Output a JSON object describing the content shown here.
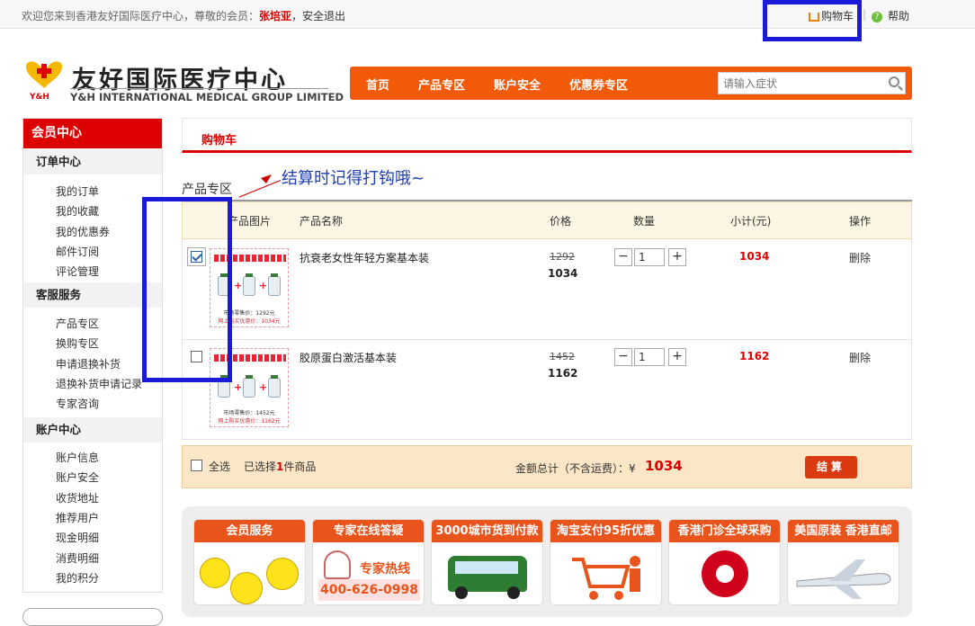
{
  "topbar": {
    "welcome": "欢迎您来到香港友好国际医疗中心，尊敬的会员：",
    "username": "张培亚",
    "logout": "，安全退出",
    "cart": "购物车",
    "separator": "|",
    "help": "帮助"
  },
  "logo": {
    "cn": "友好国际医疗中心",
    "en": "Y&H INTERNATIONAL MEDICAL GROUP LIMITED",
    "mark_text": "Y&H"
  },
  "nav": {
    "items": [
      "首页",
      "产品专区",
      "账户安全",
      "优惠券专区"
    ],
    "search_placeholder": "请输入症状"
  },
  "sidebar": {
    "title": "会员中心",
    "sections": [
      {
        "title": "订单中心",
        "items": [
          "我的订单",
          "我的收藏",
          "我的优惠券",
          "邮件订阅",
          "评论管理"
        ]
      },
      {
        "title": "客服服务",
        "items": [
          "产品专区",
          "换购专区",
          "申请退换补货",
          "退换补货申请记录",
          "专家咨询"
        ]
      },
      {
        "title": "账户中心",
        "items": [
          "账户信息",
          "账户安全",
          "收货地址",
          "推荐用户",
          "现金明细",
          "消费明细",
          "我的积分"
        ]
      }
    ]
  },
  "main": {
    "tab_title": "购物车",
    "section_title": "产品专区",
    "annotation": "结算时记得打钩哦~",
    "columns": [
      "产品图片",
      "产品名称",
      "价格",
      "数量",
      "小计(元)",
      "操作"
    ],
    "rows": [
      {
        "checked": true,
        "name": "抗衰老女性年轻方案基本装",
        "old_price": "1292",
        "price": "1034",
        "qty": "1",
        "subtotal": "1034",
        "action": "删除",
        "img_retail": "市场零售价：1292元",
        "img_online": "网上购买优惠价：1034元"
      },
      {
        "checked": false,
        "name": "胶原蛋白激活基本装",
        "old_price": "1452",
        "price": "1162",
        "qty": "1",
        "subtotal": "1162",
        "action": "删除",
        "img_retail": "市场零售价：1452元",
        "img_online": "网上购买优惠价：1162元"
      }
    ],
    "qty_minus": "−",
    "qty_plus": "+",
    "select_all": "全选",
    "selected_prefix": "已选择",
    "selected_count": "1",
    "selected_suffix": "件商品",
    "total_label": "金额总计（不含运费）：¥",
    "total_value": "1034",
    "checkout": "结算"
  },
  "promo": {
    "cards": [
      "会员服务",
      "专家在线答疑",
      "3000城市货到付款",
      "淘宝支付95折优惠",
      "香港门诊全球采购",
      "美国原装 香港直邮"
    ],
    "hotline_label": "专家热线",
    "hotline": "400-626-0998"
  },
  "colors": {
    "brand_red": "#dd0000",
    "nav_orange": "#f25a0a",
    "highlight_blue": "#1a1ad8"
  }
}
